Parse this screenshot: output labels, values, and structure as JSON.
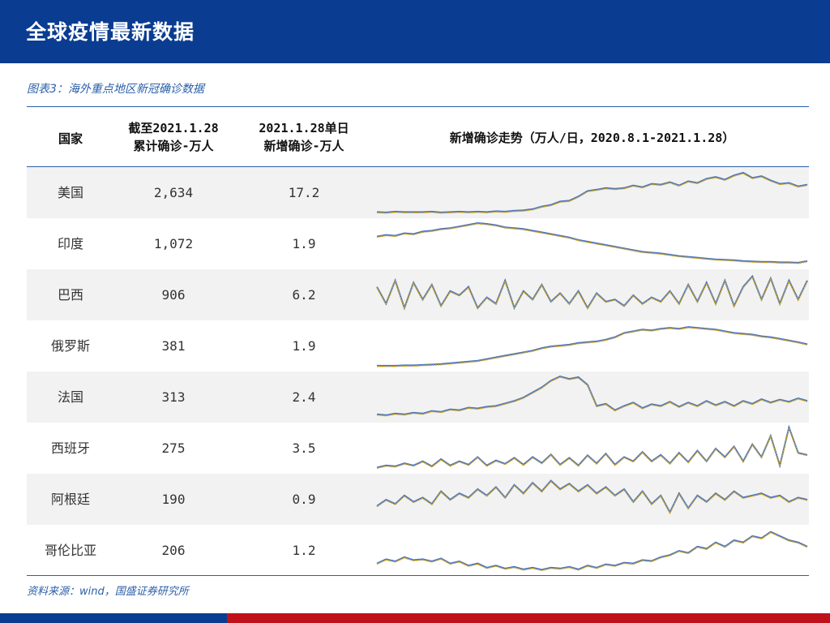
{
  "header": {
    "title": "全球疫情最新数据"
  },
  "figure": {
    "caption": "图表3：海外重点地区新冠确诊数据"
  },
  "columns": {
    "country": "国家",
    "cumulative_line1": "截至2021.1.28",
    "cumulative_line2": "累计确诊-万人",
    "daily_line1": "2021.1.28单日",
    "daily_line2": "新增确诊-万人",
    "trend": "新增确诊走势（万人/日，2020.8.1-2021.1.28）"
  },
  "rows": [
    {
      "country": "美国",
      "cumulative": "2,634",
      "daily_new": "17.2"
    },
    {
      "country": "印度",
      "cumulative": "1,072",
      "daily_new": "1.9"
    },
    {
      "country": "巴西",
      "cumulative": "906",
      "daily_new": "6.2"
    },
    {
      "country": "俄罗斯",
      "cumulative": "381",
      "daily_new": "1.9"
    },
    {
      "country": "法国",
      "cumulative": "313",
      "daily_new": "2.4"
    },
    {
      "country": "西班牙",
      "cumulative": "275",
      "daily_new": "3.5"
    },
    {
      "country": "阿根廷",
      "cumulative": "190",
      "daily_new": "0.9"
    },
    {
      "country": "哥伦比亚",
      "cumulative": "206",
      "daily_new": "1.2"
    }
  ],
  "source": {
    "note": "资料来源：wind，国盛证券研究所"
  },
  "colors": {
    "header_bg": "#0a3d91",
    "accent_blue": "#2a5fa8",
    "series_blue": "#4472c4",
    "series_gold": "#c9a227",
    "footer_red": "#c0101a",
    "row_shade": "#f2f2f2"
  },
  "chart_data": {
    "type": "line",
    "note_units": "trend per row",
    "series": [
      {
        "values": [
          0.05,
          0.04,
          0.06,
          0.05,
          0.05,
          0.05,
          0.06,
          0.04,
          0.05,
          0.06,
          0.05,
          0.06,
          0.05,
          0.07,
          0.06,
          0.08,
          0.09,
          0.12,
          0.18,
          0.22,
          0.3,
          0.32,
          0.42,
          0.55,
          0.58,
          0.62,
          0.6,
          0.62,
          0.68,
          0.64,
          0.72,
          0.7,
          0.76,
          0.68,
          0.78,
          0.74,
          0.84,
          0.88,
          0.82,
          0.92,
          0.98,
          0.86,
          0.9,
          0.8,
          0.72,
          0.74,
          0.66,
          0.7
        ]
      },
      {
        "values": [
          0.68,
          0.72,
          0.7,
          0.76,
          0.74,
          0.8,
          0.82,
          0.86,
          0.88,
          0.92,
          0.96,
          1.0,
          0.98,
          0.95,
          0.9,
          0.88,
          0.86,
          0.82,
          0.78,
          0.74,
          0.7,
          0.66,
          0.6,
          0.56,
          0.52,
          0.48,
          0.44,
          0.4,
          0.36,
          0.32,
          0.3,
          0.28,
          0.25,
          0.22,
          0.2,
          0.18,
          0.16,
          0.14,
          0.13,
          0.12,
          0.1,
          0.09,
          0.08,
          0.08,
          0.07,
          0.07,
          0.06,
          0.1
        ]
      },
      {
        "values": [
          0.7,
          0.3,
          0.85,
          0.2,
          0.8,
          0.4,
          0.75,
          0.25,
          0.6,
          0.5,
          0.7,
          0.2,
          0.45,
          0.3,
          0.85,
          0.2,
          0.6,
          0.4,
          0.75,
          0.35,
          0.55,
          0.3,
          0.6,
          0.2,
          0.55,
          0.35,
          0.4,
          0.25,
          0.5,
          0.3,
          0.45,
          0.35,
          0.6,
          0.3,
          0.75,
          0.35,
          0.8,
          0.3,
          0.85,
          0.25,
          0.7,
          0.95,
          0.4,
          0.9,
          0.3,
          0.85,
          0.4,
          0.85
        ]
      },
      {
        "values": [
          0.04,
          0.04,
          0.04,
          0.05,
          0.05,
          0.06,
          0.07,
          0.08,
          0.1,
          0.12,
          0.14,
          0.16,
          0.2,
          0.24,
          0.28,
          0.32,
          0.36,
          0.4,
          0.46,
          0.5,
          0.52,
          0.54,
          0.58,
          0.6,
          0.62,
          0.66,
          0.72,
          0.82,
          0.86,
          0.9,
          0.88,
          0.92,
          0.94,
          0.92,
          0.96,
          0.94,
          0.92,
          0.9,
          0.86,
          0.82,
          0.8,
          0.78,
          0.74,
          0.72,
          0.68,
          0.64,
          0.6,
          0.55
        ]
      },
      {
        "values": [
          0.1,
          0.08,
          0.12,
          0.1,
          0.14,
          0.12,
          0.18,
          0.16,
          0.22,
          0.2,
          0.26,
          0.24,
          0.28,
          0.3,
          0.36,
          0.42,
          0.5,
          0.62,
          0.74,
          0.9,
          1.0,
          0.94,
          0.98,
          0.8,
          0.3,
          0.35,
          0.2,
          0.3,
          0.38,
          0.25,
          0.34,
          0.3,
          0.4,
          0.28,
          0.38,
          0.3,
          0.42,
          0.32,
          0.4,
          0.3,
          0.42,
          0.35,
          0.46,
          0.38,
          0.45,
          0.4,
          0.48,
          0.42
        ]
      },
      {
        "values": [
          0.05,
          0.1,
          0.08,
          0.15,
          0.1,
          0.2,
          0.08,
          0.25,
          0.1,
          0.2,
          0.12,
          0.3,
          0.1,
          0.22,
          0.14,
          0.28,
          0.12,
          0.3,
          0.16,
          0.36,
          0.12,
          0.28,
          0.1,
          0.34,
          0.15,
          0.38,
          0.12,
          0.3,
          0.2,
          0.42,
          0.2,
          0.35,
          0.15,
          0.4,
          0.18,
          0.45,
          0.2,
          0.5,
          0.3,
          0.55,
          0.2,
          0.6,
          0.3,
          0.8,
          0.1,
          1.0,
          0.4,
          0.35
        ]
      },
      {
        "values": [
          0.35,
          0.5,
          0.4,
          0.6,
          0.45,
          0.55,
          0.4,
          0.7,
          0.5,
          0.65,
          0.55,
          0.75,
          0.6,
          0.8,
          0.55,
          0.85,
          0.65,
          0.9,
          0.7,
          0.95,
          0.75,
          0.88,
          0.7,
          0.85,
          0.65,
          0.8,
          0.6,
          0.75,
          0.45,
          0.7,
          0.4,
          0.6,
          0.2,
          0.65,
          0.3,
          0.6,
          0.45,
          0.65,
          0.5,
          0.7,
          0.55,
          0.6,
          0.65,
          0.55,
          0.6,
          0.45,
          0.55,
          0.5
        ]
      },
      {
        "values": [
          0.2,
          0.3,
          0.25,
          0.35,
          0.28,
          0.3,
          0.25,
          0.32,
          0.2,
          0.25,
          0.15,
          0.2,
          0.1,
          0.15,
          0.08,
          0.12,
          0.06,
          0.1,
          0.05,
          0.1,
          0.08,
          0.12,
          0.06,
          0.15,
          0.1,
          0.18,
          0.15,
          0.22,
          0.2,
          0.28,
          0.26,
          0.35,
          0.4,
          0.5,
          0.45,
          0.6,
          0.55,
          0.7,
          0.6,
          0.75,
          0.7,
          0.85,
          0.8,
          0.95,
          0.85,
          0.75,
          0.7,
          0.6
        ]
      }
    ]
  }
}
